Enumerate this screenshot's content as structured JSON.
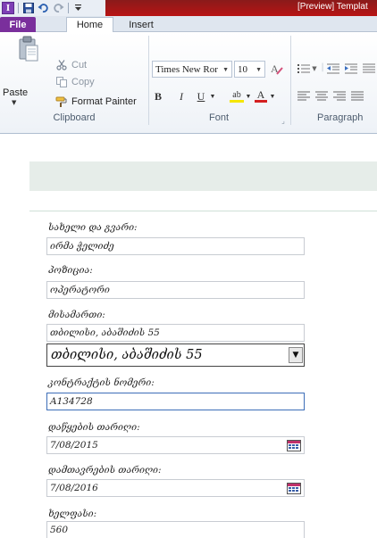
{
  "window": {
    "title": "[Preview] Templat",
    "app_icon_letter": "I"
  },
  "tabs": [
    {
      "label": "File"
    },
    {
      "label": "Home"
    },
    {
      "label": "Insert"
    }
  ],
  "ribbon": {
    "clipboard": {
      "paste_label": "Paste",
      "cut_label": "Cut",
      "copy_label": "Copy",
      "format_painter_label": "Format Painter",
      "group_label": "Clipboard"
    },
    "font": {
      "font_name": "Times New Ror",
      "font_size": "10",
      "bold": "B",
      "italic": "I",
      "underline": "U",
      "highlight": "ab",
      "font_color": "A",
      "group_label": "Font"
    },
    "paragraph": {
      "group_label": "Paragraph"
    }
  },
  "form": {
    "name_label": "სახელი და გვარი:",
    "name_value": "ირმა ჭელიძე",
    "position_label": "პოზიცია:",
    "position_value": "ოპერატორი",
    "address_label": "მისამართი:",
    "address_value": "თბილისი, აბაშიძის 55",
    "address_combo_value": "თბილისი, აბაშიძის 55",
    "contract_label": "კონტრაქტის ნომერი:",
    "contract_value": "A134728",
    "start_date_label": "დაწყების თარიღი:",
    "start_date_value": "7/08/2015",
    "end_date_label": "დამთავრების თარიღი:",
    "end_date_value": "7/08/2016",
    "salary_label": "ხელფასი:",
    "salary_value": "560"
  },
  "colors": {
    "title_bar": "#b81414",
    "file_tab": "#7a2f9c",
    "header_band": "#e6ede9",
    "active_field_border": "#3d6eb8"
  }
}
